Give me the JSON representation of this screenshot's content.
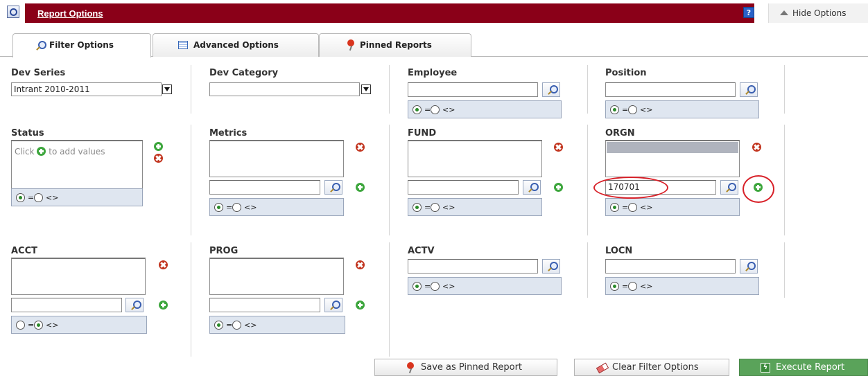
{
  "header": {
    "title": "Report Options",
    "help_label": "?",
    "hide_label": "Hide Options"
  },
  "tabs": [
    {
      "label": "Filter Options",
      "active": true
    },
    {
      "label": "Advanced Options",
      "active": false
    },
    {
      "label": "Pinned Reports",
      "active": false
    }
  ],
  "filters": {
    "dev_series": {
      "label": "Dev Series",
      "value": "Intrant 2010-2011"
    },
    "dev_category": {
      "label": "Dev Category",
      "value": ""
    },
    "employee": {
      "label": "Employee",
      "value": ""
    },
    "position": {
      "label": "Position",
      "value": ""
    },
    "status": {
      "label": "Status",
      "hint_prefix": "Click",
      "hint_suffix": "to add values"
    },
    "metrics": {
      "label": "Metrics",
      "value": ""
    },
    "fund": {
      "label": "FUND",
      "value": ""
    },
    "orgn": {
      "label": "ORGN",
      "value": "170701"
    },
    "acct": {
      "label": "ACCT",
      "value": ""
    },
    "prog": {
      "label": "PROG",
      "value": ""
    },
    "actv": {
      "label": "ACTV",
      "value": ""
    },
    "locn": {
      "label": "LOCN",
      "value": ""
    }
  },
  "operators": {
    "eq": "=",
    "neq": "<>"
  },
  "buttons": {
    "save_pinned": "Save as Pinned Report",
    "clear": "Clear Filter Options",
    "execute": "Execute Report"
  },
  "colors": {
    "header_red": "#8a0018",
    "execute_green": "#5aa35a"
  }
}
